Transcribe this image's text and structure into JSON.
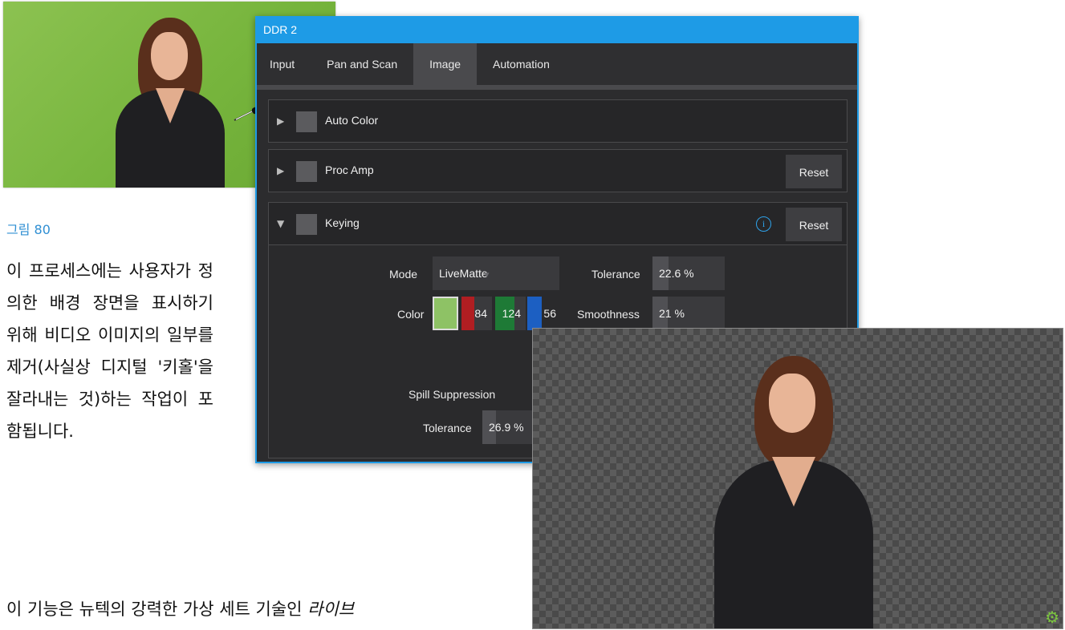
{
  "figure_caption": "그림 80",
  "paragraph_1": "이 프로세스에는 사용자가 정의한 배경 장면을 표시하기 위해 비디오 이미지의 일부를 제거(사실상 디지털 '키홀'을 잘라내는 것)하는 작업이 포함됩니다.",
  "paragraph_2_prefix": "이 기능은 뉴텍의 강력한 가상 세트 기술인 ",
  "paragraph_2_italic": "라이브",
  "panel": {
    "title": "DDR 2",
    "tabs": [
      "Input",
      "Pan and Scan",
      "Image",
      "Automation"
    ],
    "active_tab": "Image",
    "sections": {
      "auto_color": {
        "label": "Auto Color"
      },
      "proc_amp": {
        "label": "Proc Amp",
        "reset": "Reset"
      },
      "keying": {
        "label": "Keying",
        "reset": "Reset",
        "info": "i"
      }
    },
    "keying": {
      "mode_label": "Mode",
      "mode_value": "LiveMatte",
      "tolerance_label": "Tolerance",
      "tolerance_value": "22.6 %",
      "tolerance_fraction": 0.226,
      "color_label": "Color",
      "color_hex": "#8ec265",
      "color_r": "84",
      "color_g": "124",
      "color_b": "56",
      "smoothness_label": "Smoothness",
      "smoothness_value": "21 %",
      "smoothness_fraction": 0.21,
      "spill_label": "Spill Suppression",
      "spill_tolerance_label": "Tolerance",
      "spill_tolerance_value": "26.9 %",
      "spill_tolerance_fraction": 0.269
    }
  },
  "colors": {
    "accent": "#1e9be6",
    "green_screen": "#7ab83f",
    "caption": "#2f8fd3",
    "gear": "#7cc440"
  },
  "icons": [
    "eyedropper-icon",
    "chevron-right-icon",
    "chevron-down-icon",
    "info-icon",
    "gear-icon"
  ]
}
